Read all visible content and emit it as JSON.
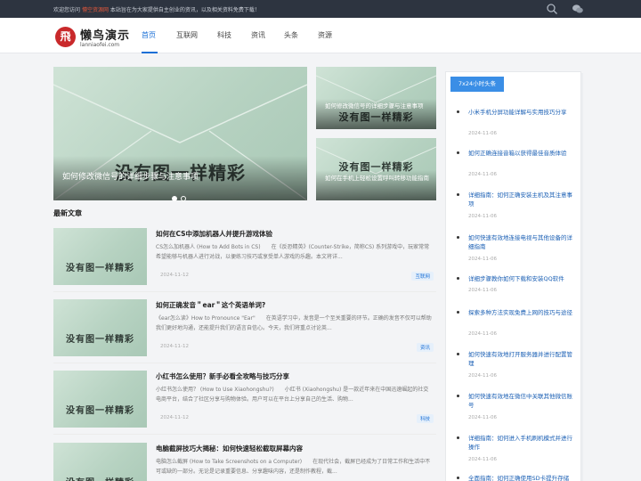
{
  "topbar": {
    "welcome": "欢迎您访问",
    "site_name": "懵空资源网",
    "notice": "本站旨在为大家提供自主创业的资讯，以及相关资料免费下载！"
  },
  "header": {
    "logo_glyph": "飛",
    "logo_title": "懒鸟演示",
    "logo_sub": "lanniaofei.com",
    "nav": [
      "首页",
      "互联网",
      "科技",
      "资讯",
      "头条",
      "资源"
    ]
  },
  "slider": {
    "placeholder": "没有图一样精彩",
    "main_caption": "如何修改微信号的详细步骤与注意事项",
    "side1_caption": "如何修改微信号的详细步骤与注意事项",
    "side2_caption": "如何在手机上轻松设置呼叫转移功能指南"
  },
  "section_title": "最新文章",
  "articles": [
    {
      "title": "如何在CS中添加机器人并提升游戏体验",
      "desc": "CS怎么加机器人 (How to Add Bots in CS)　　在《反恐精英》(Counter-Strike，简称CS) 系列游戏中，玩家常常希望能够与机器人进行对战，以便练习技巧或享受单人游戏的乐趣。本文将详...",
      "date": "2024-11-12",
      "tag": "互联网"
    },
    {
      "title": "如何正确发音＂ear＂这个英语单词?",
      "desc": "《ear怎么读》How to Pronounce \"Ear\"　　在英语学习中，发音是一个至关重要的环节。正确的发音不仅可以帮助我们更好地沟通，还能提升我们的语言自信心。今天，我们将重点讨论英...",
      "date": "2024-11-12",
      "tag": "资讯"
    },
    {
      "title": "小红书怎么使用？新手必看全攻略与技巧分享",
      "desc": "小红书怎么使用？ (How to Use Xiaohongshu?)　　小红书 (Xiaohongshu) 是一款近年来在中国迅速崛起的社交电商平台，结合了社区分享与购物体验。用户可以在平台上分享自己的生活、购物...",
      "date": "2024-11-12",
      "tag": "科技"
    },
    {
      "title": "电脑截屏技巧大揭秘：如何快速轻松截取屏幕内容",
      "desc": "电脑怎么截屏 (How to Take Screenshots on a Computer)　　在现代社会，截屏已经成为了日常工作和生活中不可或缺的一部分。无论是记录重要信息、分享趣味内容，还是制作教程，截...",
      "date": "2024-11-12",
      "tag": ""
    }
  ],
  "sidebar": {
    "tab": "7x24小时头条",
    "items": [
      {
        "title": "小米手机分屏功能详解与实用技巧分享",
        "date": "2024-11-06"
      },
      {
        "title": "如何正确连接音箱以获得最佳音质体验",
        "date": "2024-11-06"
      },
      {
        "title": "详细指南：如何正确安装主机及其注意事项",
        "date": "2024-11-06"
      },
      {
        "title": "如何快速有效地连接电视与其他设备的详细指南",
        "date": "2024-11-06"
      },
      {
        "title": "详细步骤教你如何下载和安装QQ软件",
        "date": "2024-11-06"
      },
      {
        "title": "探索多种方法实现免费上网的技巧与途径",
        "date": "2024-11-06"
      },
      {
        "title": "如何快速有效地打开服务器并进行配置管理",
        "date": "2024-11-06"
      },
      {
        "title": "如何快速有效地在微信中关联其他微信账号",
        "date": "2024-11-06"
      },
      {
        "title": "详细指南：如何进入手机刷机模式并进行操作",
        "date": "2024-11-06"
      },
      {
        "title": "全面指南：如何正确使用SD卡提升存储",
        "date": ""
      }
    ]
  },
  "colors": {
    "accent": "#1a6fd6",
    "topbar": "#2d3440",
    "brand_red": "#c9292b",
    "sidebar_tab": "#3a8ee6"
  },
  "icons": {
    "search": "search-icon",
    "wechat": "wechat-icon"
  }
}
